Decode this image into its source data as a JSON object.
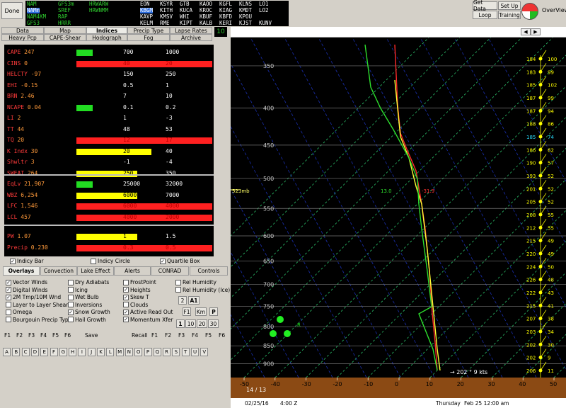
{
  "toolbar": {
    "done": "Done",
    "get_data": "Get Data",
    "set_up": "Set Up",
    "loop": "Loop",
    "training": "Training",
    "overview": "OverView"
  },
  "models": [
    [
      "NAM",
      "GFS3m",
      "HRWARW"
    ],
    [
      "NAMm",
      "SREF",
      "HRWNMM"
    ],
    [
      "NAM4KM",
      "RAP",
      ""
    ],
    [
      "GFS3",
      "HRRR",
      ""
    ]
  ],
  "stations": [
    [
      "",
      "EON",
      "KSYR",
      "GTB",
      "KAOO",
      "KGFL",
      "KLNS",
      "LO1"
    ],
    [
      "",
      "KBGM",
      "KITH",
      "KUCA",
      "KROC",
      "KIAG",
      "KMDT",
      "LO2"
    ],
    [
      "",
      "KAVP",
      "KMSV",
      "WHI",
      "KBUF",
      "KBFD",
      "KPOU",
      ""
    ],
    [
      "",
      "KELM",
      "RME",
      "KIPT",
      "KALB",
      "KERI",
      "KJST",
      "KUNV"
    ]
  ],
  "tabs_row1": [
    "Data",
    "Map",
    "Indices",
    "Precip Type",
    "Lapse Rates"
  ],
  "tabs_row2": [
    "Heavy Pcp",
    "CAPE-Shear",
    "Hodograph",
    "Fog",
    "Archive"
  ],
  "frame_number": "10",
  "indices": {
    "group1": [
      {
        "label": "CAPE",
        "value": "247",
        "t1": "700",
        "t2": "1000"
      },
      {
        "label": "CINS",
        "value": "0",
        "t1": "40",
        "t2": "20"
      },
      {
        "label": "HELCTY",
        "value": "-97",
        "t1": "150",
        "t2": "250"
      },
      {
        "label": "EHI",
        "value": "-0.15",
        "t1": "0.5",
        "t2": "1"
      },
      {
        "label": "BRN",
        "value": "2.46",
        "t1": "7",
        "t2": "10"
      },
      {
        "label": "NCAPE",
        "value": "0.04",
        "t1": "0.1",
        "t2": "0.2"
      },
      {
        "label": "LI",
        "value": "2",
        "t1": "1",
        "t2": "-3"
      },
      {
        "label": "TT",
        "value": "44",
        "t1": "48",
        "t2": "53"
      },
      {
        "label": "TQ",
        "value": "20",
        "t1": "12",
        "t2": "17"
      },
      {
        "label": "K Indx",
        "value": "30",
        "t1": "20",
        "t2": "40"
      },
      {
        "label": "Shwltr",
        "value": "3",
        "t1": "-1",
        "t2": "-4"
      },
      {
        "label": "SWEAT",
        "value": "264",
        "t1": "250",
        "t2": "350"
      }
    ],
    "group2": [
      {
        "label": "EqLv",
        "value": "21,907",
        "t1": "25000",
        "t2": "32000"
      },
      {
        "label": "WBZ",
        "value": "6,254",
        "t1": "6000",
        "t2": "7000"
      },
      {
        "label": "LFC",
        "value": "1,546",
        "t1": "6000",
        "t2": "4000"
      },
      {
        "label": "LCL",
        "value": "457",
        "t1": "4000",
        "t2": "2000"
      }
    ],
    "group3": [
      {
        "label": "PW",
        "value": "1.07",
        "t1": "1",
        "t2": "1.5"
      },
      {
        "label": "Precip",
        "value": "0.230",
        "t1": "0.3",
        "t2": "0.5"
      }
    ],
    "bars": {
      "CAPE": {
        "color": "#22dd22",
        "frac": 0.12
      },
      "CINS": {
        "color": "#ff2020",
        "frac": 1.0
      },
      "NCAPE": {
        "color": "#22dd22",
        "frac": 0.12
      },
      "TQ": {
        "color": "#ff2020",
        "frac": 1.0
      },
      "K Indx": {
        "color": "#ffff00",
        "frac": 0.55
      },
      "SWEAT": {
        "color": "#ffff00",
        "frac": 0.45
      },
      "EqLv": {
        "color": "#22dd22",
        "frac": 0.12
      },
      "WBZ": {
        "color": "#ffff00",
        "frac": 0.45
      },
      "LFC": {
        "color": "#ff2020",
        "frac": 1.0
      },
      "LCL": {
        "color": "#ff2020",
        "frac": 1.0
      },
      "PW": {
        "color": "#ffff00",
        "frac": 0.45
      },
      "Precip": {
        "color": "#ff2020",
        "frac": 1.0
      }
    }
  },
  "indices_options": {
    "bar": "Indicy Bar",
    "circle": "Indicy Circle",
    "quartile": "Quartile Box"
  },
  "overlay_tabs": [
    "Overlays",
    "Convection",
    "Lake Effect",
    "Alerts",
    "CONRAD",
    "Controls"
  ],
  "overlay_col1": [
    "Vector Winds",
    "Digital Winds",
    "2M Tmp/10M Wnd",
    "Layer to Layer Shear",
    "Omega",
    "Bourgouin Precip Type"
  ],
  "overlay_col2": [
    "Dry Adiabats",
    "Icing",
    "Wet Bulb",
    "Inversions",
    "Snow Growth",
    "Hail Growth"
  ],
  "overlay_col3": [
    "FrostPoint",
    "Heights",
    "Skew T",
    "Clouds",
    "Active Read Out",
    "Momentum Xfer"
  ],
  "overlay_col4": [
    "Rel Humidity",
    "Rel Humidity (Ice)"
  ],
  "overlay_checked": {
    "Vector Winds": true,
    "Digital Winds": true,
    "2M Tmp/10M Wnd": true,
    "Snow Growth": true,
    "Heights": true,
    "Skew T": true,
    "Active Read Out": true,
    "Momentum Xfer": true
  },
  "small_buttons": {
    "two": "2",
    "a1": "A1",
    "f1": "F1",
    "km": "Km",
    "p": "P",
    "one": "1",
    "ten": "10",
    "twenty": "20",
    "thirty": "30"
  },
  "fkeys_left": [
    "F1",
    "F2",
    "F3",
    "F4",
    "F5",
    "F6"
  ],
  "save": "Save",
  "recall": "Recall",
  "fkeys_right": [
    "F1",
    "F2",
    "F3",
    "F4",
    "F5",
    "F6"
  ],
  "letters": [
    "A",
    "B",
    "C",
    "D",
    "E",
    "F",
    "G",
    "H",
    "I",
    "J",
    "K",
    "L",
    "M",
    "N",
    "O",
    "P",
    "Q",
    "R",
    "S",
    "T",
    "U",
    "V"
  ],
  "skewt": {
    "pressure_levels": [
      350,
      400,
      450,
      500,
      550,
      600,
      650,
      700,
      750,
      800,
      850,
      900
    ],
    "temp_ticks": [
      -50,
      -40,
      -30,
      -20,
      -10,
      0,
      10,
      20,
      30,
      40,
      50
    ],
    "readout_level": "523mb",
    "readout_td": "13.0",
    "readout_t": "-31.9",
    "surface_wind": "202 ° 9 kts",
    "surface_t_td": "14 / 13",
    "right_heights": [
      {
        "h": "184",
        "v": "100"
      },
      {
        "h": "183",
        "v": "99"
      },
      {
        "h": "185",
        "v": "102"
      },
      {
        "h": "187",
        "v": "99"
      },
      {
        "h": "187",
        "v": "94"
      },
      {
        "h": "188",
        "v": "86"
      },
      {
        "h": "185",
        "v": "74"
      },
      {
        "h": "186",
        "v": "62"
      },
      {
        "h": "190",
        "v": "57"
      },
      {
        "h": "193",
        "v": "52"
      },
      {
        "h": "201",
        "v": "52"
      },
      {
        "h": "205",
        "v": "52"
      },
      {
        "h": "208",
        "v": "55"
      },
      {
        "h": "212",
        "v": "55"
      },
      {
        "h": "215",
        "v": "49"
      },
      {
        "h": "220",
        "v": "49"
      },
      {
        "h": "224",
        "v": "50"
      },
      {
        "h": "226",
        "v": "48"
      },
      {
        "h": "222",
        "v": "43"
      },
      {
        "h": "215",
        "v": "41"
      },
      {
        "h": "207",
        "v": "38"
      },
      {
        "h": "203",
        "v": "34"
      },
      {
        "h": "202",
        "v": "30"
      },
      {
        "h": "202",
        "v": "9"
      },
      {
        "h": "206",
        "v": "11"
      }
    ],
    "hodo_label": "R"
  },
  "status": {
    "date": "02/25/16",
    "time": "4:00 Z",
    "day": "Thursday",
    "valid": "Feb 25  12:00 am"
  }
}
